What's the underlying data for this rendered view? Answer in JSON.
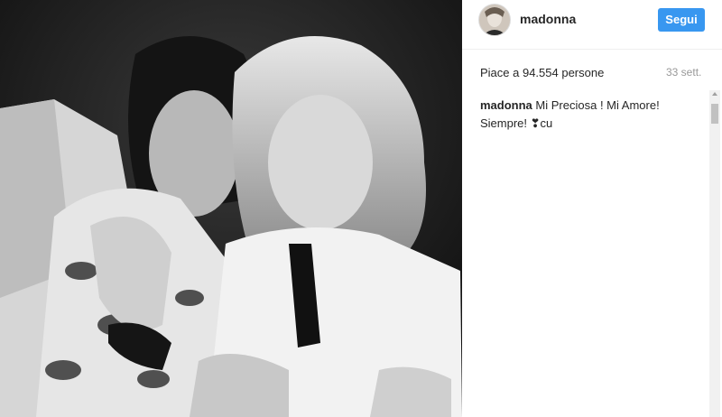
{
  "post": {
    "username": "madonna",
    "follow_label": "Segui",
    "likes": "Piace a 94.554 persone",
    "time": "33 sett."
  },
  "caption": {
    "username": "madonna",
    "text": "Mi Preciosa ! Mi Amore! Siempre! ❣cu"
  },
  "colors": {
    "follow_button": "#3897f0",
    "text": "#262626",
    "muted": "#999999"
  }
}
